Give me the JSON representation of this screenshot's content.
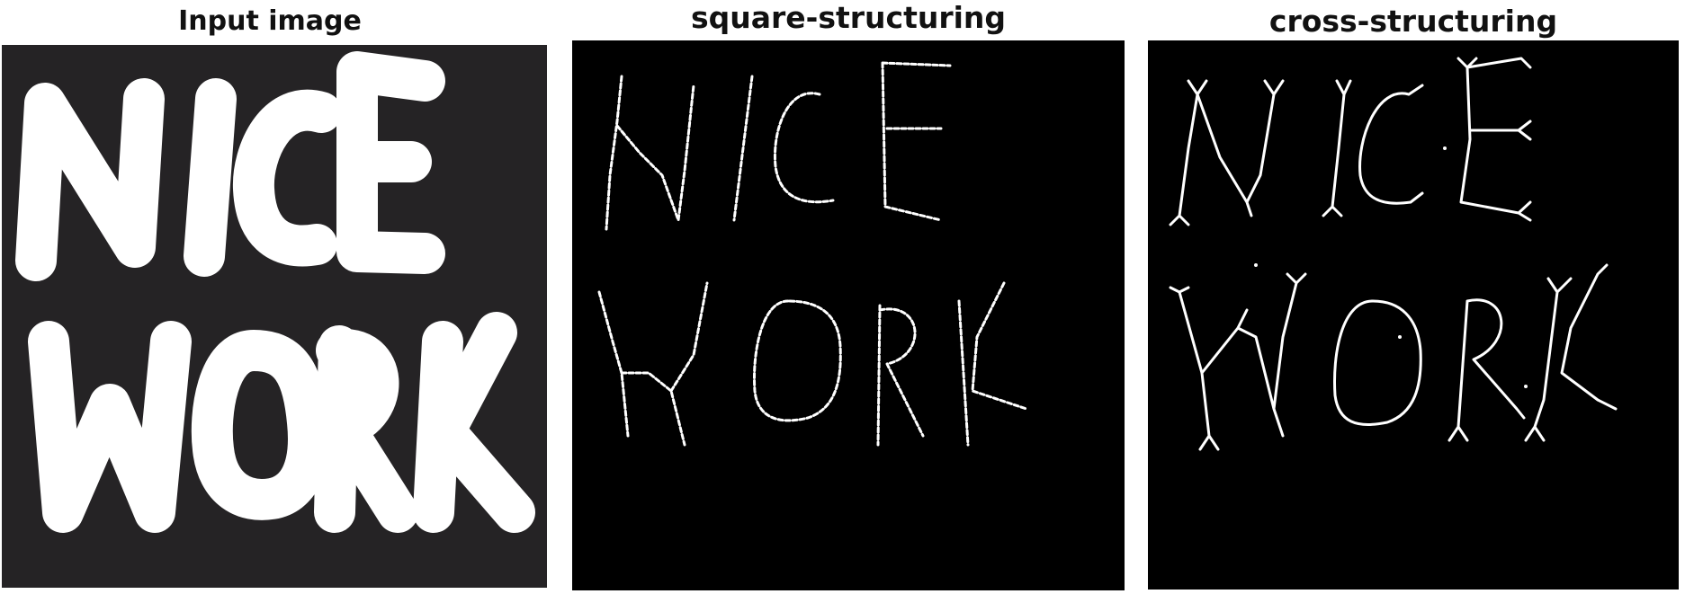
{
  "panels": [
    {
      "title": "Input image",
      "content": "thick white hand-lettered text on dark background"
    },
    {
      "title": "square-structuring",
      "content": "thin dotted skeleton of the lettering"
    },
    {
      "title": "cross-structuring",
      "content": "thin continuous skeleton of the lettering with branch tips"
    }
  ],
  "colors": {
    "background_input": "#252325",
    "background_output": "#000000",
    "foreground": "#ffffff"
  }
}
